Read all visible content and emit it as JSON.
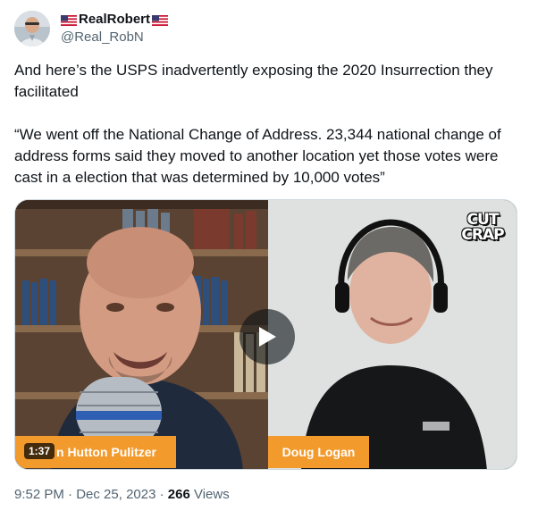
{
  "author": {
    "display_name": "RealRobert",
    "handle": "@Real_RobN",
    "avatar_icon": "profile-photo",
    "flag_icon": "us-flag-emoji"
  },
  "tweet": {
    "paragraph_1": "And here’s the USPS inadvertently exposing the 2020 Insurrection they facilitated",
    "paragraph_2": "“We went off the National Change of Address. 23,344 national change of address forms said they moved to another location yet those votes were cast in a election that was determined by 10,000 votes”"
  },
  "video": {
    "duration": "1:37",
    "left_name_tag": "n Hutton Pulitzer",
    "right_name_tag": "Doug Logan",
    "logo_line_1": "CUT",
    "logo_line_2": "CRAP",
    "play_icon": "play-icon",
    "name_tag_color": "#f39a2c"
  },
  "meta": {
    "time": "9:52 PM",
    "separator": " · ",
    "date": "Dec 25, 2023",
    "views_count": "266",
    "views_label": " Views"
  },
  "colors": {
    "text_primary": "#0f1419",
    "text_secondary": "#536471",
    "border": "#cfd9de"
  }
}
